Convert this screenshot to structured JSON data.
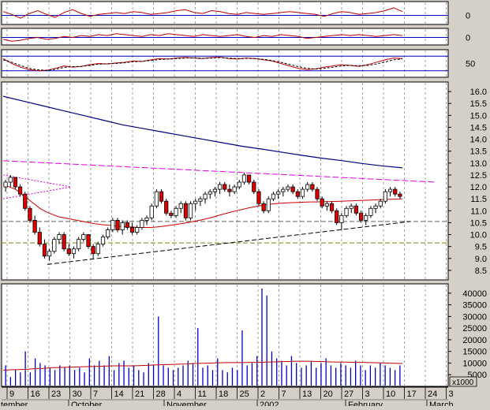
{
  "colors": {
    "background": "#d4d0c8",
    "panel": "#ffffff",
    "border": "#000000",
    "grid": "#a0a0a0",
    "price_up": "#ffffff",
    "price_down": "#e00000",
    "ma_short": "#d00000",
    "ma_long": "#000080",
    "channel": "#e000e0",
    "trend": "#000000",
    "support": "#808000",
    "volume": "#0000c0",
    "volume_ma": "#c00000",
    "indicator": "#c00000",
    "ref_line": "#0000c0"
  },
  "chart_data": [
    {
      "type": "line",
      "panel": "oscillator-1",
      "y_tick_labels": [
        "0"
      ],
      "series": [
        {
          "values": [
            0.4,
            0.1,
            -0.3,
            0.2,
            0.5,
            0.1,
            -0.2,
            0.3,
            0.6,
            0.2,
            -0.1,
            0.1,
            0.2,
            0.3,
            0.2,
            0.4,
            0.3,
            0.1,
            0.2,
            0.3,
            0.5,
            0.6,
            0.3,
            0.2,
            0.5,
            0.4,
            0.2,
            0.1,
            0.3,
            0.2,
            0.1,
            0.2,
            0.3,
            0.4,
            0.3,
            0.2,
            0.1,
            -0.1,
            0.2,
            0.4,
            0.3,
            0.1,
            0.2,
            0.3,
            0.5,
            0.8,
            0.4
          ]
        }
      ]
    },
    {
      "type": "line",
      "panel": "oscillator-2",
      "y_tick_labels": [
        "0"
      ],
      "series": [
        {
          "values": [
            -0.2,
            -0.4,
            -0.3,
            -0.1,
            0.0,
            -0.2,
            -0.1,
            0.1,
            0.0,
            0.2,
            0.1,
            0.3,
            0.2,
            0.4,
            0.3,
            0.2,
            0.1,
            0.3,
            0.2,
            0.4,
            0.3,
            0.2,
            0.1,
            0.3,
            0.2,
            0.1,
            0.2,
            0.3,
            0.1,
            0.0,
            0.2,
            0.1,
            0.3,
            0.2,
            0.1,
            -0.1,
            0.0,
            0.1,
            0.2,
            0.3,
            0.2,
            0.3,
            0.2,
            0.1,
            0.2,
            0.3,
            0.2
          ]
        }
      ]
    },
    {
      "type": "line",
      "panel": "stochastic",
      "y_tick_labels": [
        "50"
      ],
      "series": [
        {
          "values": [
            70,
            50,
            35,
            25,
            20,
            22,
            30,
            40,
            35,
            38,
            45,
            50,
            48,
            52,
            55,
            60,
            58,
            65,
            70,
            68,
            72,
            75,
            72,
            70,
            74,
            76,
            70,
            68,
            72,
            70,
            65,
            60,
            50,
            40,
            30,
            25,
            28,
            35,
            40,
            45,
            42,
            38,
            45,
            55,
            65,
            72,
            70
          ]
        },
        {
          "values": [
            65,
            55,
            42,
            30,
            24,
            22,
            26,
            34,
            37,
            38,
            42,
            47,
            49,
            50,
            53,
            57,
            59,
            62,
            66,
            68,
            70,
            72,
            73,
            71,
            72,
            74,
            72,
            70,
            71,
            70,
            67,
            62,
            55,
            46,
            37,
            30,
            27,
            30,
            35,
            40,
            42,
            41,
            42,
            48,
            56,
            65,
            69
          ]
        }
      ]
    },
    {
      "type": "line",
      "panel": "price",
      "y_tick_labels": [
        "8.5",
        "9.0",
        "9.5",
        "10.0",
        "10.5",
        "11.0",
        "11.5",
        "12.0",
        "12.5",
        "13.0",
        "13.5",
        "14.0",
        "14.5",
        "15.0",
        "15.5",
        "16.0"
      ],
      "ylim": [
        8.1,
        16.4
      ],
      "x_tick_labels": [
        "9",
        "16",
        "23",
        "30",
        "7",
        "14",
        "21",
        "28",
        "4",
        "11",
        "18",
        "25",
        "2",
        "7",
        "13",
        "20",
        "27",
        "3",
        "10",
        "17",
        "24",
        "3"
      ],
      "month_labels": [
        "tember",
        "October",
        "November",
        "2002",
        "February",
        "March"
      ],
      "ohlc": [
        [
          12.0,
          12.3,
          11.8,
          12.2
        ],
        [
          12.2,
          12.5,
          12.0,
          12.4
        ],
        [
          12.4,
          12.4,
          11.9,
          12.0
        ],
        [
          12.0,
          12.1,
          11.6,
          11.7
        ],
        [
          11.7,
          11.8,
          11.0,
          11.1
        ],
        [
          11.1,
          11.2,
          10.5,
          10.6
        ],
        [
          10.6,
          10.8,
          10.0,
          10.1
        ],
        [
          10.1,
          10.3,
          9.5,
          9.6
        ],
        [
          9.6,
          9.8,
          9.0,
          9.1
        ],
        [
          9.1,
          9.4,
          8.9,
          9.3
        ],
        [
          9.3,
          9.9,
          9.2,
          9.8
        ],
        [
          9.8,
          10.1,
          9.6,
          10.0
        ],
        [
          10.0,
          10.1,
          9.3,
          9.4
        ],
        [
          9.4,
          9.6,
          9.1,
          9.2
        ],
        [
          9.2,
          9.5,
          9.0,
          9.4
        ],
        [
          9.4,
          9.9,
          9.3,
          9.8
        ],
        [
          9.8,
          10.1,
          9.7,
          10.0
        ],
        [
          10.0,
          10.0,
          9.4,
          9.5
        ],
        [
          9.5,
          9.6,
          9.0,
          9.2
        ],
        [
          9.2,
          9.7,
          9.1,
          9.6
        ],
        [
          9.6,
          10.0,
          9.5,
          9.9
        ],
        [
          9.9,
          10.3,
          9.8,
          10.2
        ],
        [
          10.2,
          10.7,
          10.1,
          10.6
        ],
        [
          10.6,
          10.7,
          10.1,
          10.2
        ],
        [
          10.2,
          10.6,
          10.0,
          10.5
        ],
        [
          10.5,
          10.6,
          10.2,
          10.3
        ],
        [
          10.3,
          10.5,
          10.0,
          10.1
        ],
        [
          10.1,
          10.4,
          10.0,
          10.3
        ],
        [
          10.3,
          10.7,
          10.2,
          10.6
        ],
        [
          10.6,
          10.8,
          10.4,
          10.7
        ],
        [
          10.7,
          11.3,
          10.6,
          11.2
        ],
        [
          11.2,
          11.9,
          11.1,
          11.8
        ],
        [
          11.8,
          11.9,
          11.3,
          11.4
        ],
        [
          11.4,
          11.5,
          10.8,
          10.9
        ],
        [
          10.9,
          11.0,
          10.7,
          10.8
        ],
        [
          10.8,
          11.2,
          10.7,
          11.1
        ],
        [
          11.1,
          11.4,
          10.9,
          11.3
        ],
        [
          11.3,
          11.4,
          10.6,
          10.7
        ],
        [
          10.7,
          11.4,
          10.6,
          11.3
        ],
        [
          11.3,
          11.5,
          11.0,
          11.4
        ],
        [
          11.4,
          11.6,
          11.2,
          11.5
        ],
        [
          11.5,
          11.8,
          11.3,
          11.7
        ],
        [
          11.7,
          11.9,
          11.5,
          11.8
        ],
        [
          11.8,
          12.0,
          11.6,
          11.9
        ],
        [
          11.9,
          12.2,
          11.7,
          12.1
        ],
        [
          12.1,
          12.2,
          11.8,
          11.9
        ],
        [
          11.9,
          12.1,
          11.6,
          11.8
        ],
        [
          11.8,
          12.1,
          11.7,
          12.0
        ],
        [
          12.0,
          12.3,
          11.9,
          12.2
        ],
        [
          12.2,
          12.6,
          12.1,
          12.5
        ],
        [
          12.5,
          12.5,
          12.1,
          12.2
        ],
        [
          12.2,
          12.3,
          11.7,
          11.8
        ],
        [
          11.8,
          11.9,
          11.2,
          11.3
        ],
        [
          11.3,
          11.4,
          10.9,
          11.0
        ],
        [
          11.0,
          11.6,
          10.9,
          11.5
        ],
        [
          11.5,
          11.8,
          11.4,
          11.7
        ],
        [
          11.7,
          11.9,
          11.5,
          11.8
        ],
        [
          11.8,
          12.0,
          11.6,
          11.9
        ],
        [
          11.9,
          12.1,
          11.8,
          12.0
        ],
        [
          12.0,
          12.1,
          11.7,
          11.8
        ],
        [
          11.8,
          11.9,
          11.5,
          11.6
        ],
        [
          11.6,
          12.0,
          11.5,
          11.9
        ],
        [
          11.9,
          12.2,
          11.8,
          12.1
        ],
        [
          12.1,
          12.2,
          11.8,
          11.9
        ],
        [
          11.9,
          12.0,
          11.4,
          11.5
        ],
        [
          11.5,
          11.6,
          11.1,
          11.2
        ],
        [
          11.2,
          11.4,
          11.0,
          11.3
        ],
        [
          11.3,
          11.4,
          10.9,
          11.0
        ],
        [
          11.0,
          11.1,
          10.4,
          10.5
        ],
        [
          10.5,
          10.9,
          10.2,
          10.8
        ],
        [
          10.8,
          11.2,
          10.7,
          11.1
        ],
        [
          11.1,
          11.3,
          10.9,
          11.2
        ],
        [
          11.2,
          11.3,
          10.8,
          10.9
        ],
        [
          10.9,
          11.0,
          10.5,
          10.6
        ],
        [
          10.6,
          10.9,
          10.4,
          10.8
        ],
        [
          10.8,
          11.2,
          10.7,
          11.1
        ],
        [
          11.1,
          11.3,
          10.9,
          11.2
        ],
        [
          11.2,
          11.5,
          11.1,
          11.4
        ],
        [
          11.4,
          11.9,
          11.3,
          11.8
        ],
        [
          11.8,
          12.0,
          11.6,
          11.9
        ],
        [
          11.9,
          12.0,
          11.6,
          11.7
        ],
        [
          11.7,
          11.8,
          11.5,
          11.6
        ]
      ],
      "ma_short": [
        12.1,
        12.0,
        11.9,
        11.7,
        11.5,
        11.3,
        11.1,
        10.95,
        10.85,
        10.75,
        10.7,
        10.65,
        10.6,
        10.55,
        10.5,
        10.45,
        10.42,
        10.4,
        10.37,
        10.35,
        10.33,
        10.32,
        10.3,
        10.3,
        10.3,
        10.32,
        10.35,
        10.38,
        10.42,
        10.46,
        10.5,
        10.55,
        10.6,
        10.66,
        10.72,
        10.8,
        10.87,
        10.94,
        11.0,
        11.06,
        11.12,
        11.17,
        11.22,
        11.26,
        11.29,
        11.31,
        11.33,
        11.34,
        11.35,
        11.36,
        11.37,
        11.37,
        11.38,
        11.38,
        11.39,
        11.4,
        11.41,
        11.42,
        11.43,
        11.44,
        11.45,
        11.46,
        11.47,
        11.48,
        11.49,
        11.5
      ],
      "ma_long": [
        15.8,
        15.6,
        15.4,
        15.2,
        15.0,
        14.8,
        14.6,
        14.45,
        14.3,
        14.15,
        14.0,
        13.85,
        13.7,
        13.58,
        13.45,
        13.32,
        13.2,
        13.1,
        12.98,
        12.88,
        12.8
      ],
      "channel": [
        13.1,
        12.2
      ],
      "trend_support": [
        8.75,
        10.55
      ],
      "support_level": 9.65,
      "resistance_level": 10.55,
      "dashed_wedge": [
        [
          12.5,
          12.0
        ],
        [
          11.5,
          12.0
        ]
      ]
    },
    {
      "type": "bar",
      "panel": "volume",
      "y_tick_labels": [
        "5000",
        "10000",
        "15000",
        "20000",
        "25000",
        "30000",
        "35000",
        "40000"
      ],
      "ylim": [
        0,
        44000
      ],
      "unit_label": "x1000",
      "values": [
        9000,
        4000,
        7000,
        6000,
        15000,
        6000,
        12000,
        10000,
        9000,
        8000,
        7000,
        9000,
        8000,
        9000,
        7000,
        8000,
        6000,
        12000,
        9000,
        11000,
        9000,
        13000,
        7000,
        10000,
        11000,
        8000,
        9000,
        7000,
        6000,
        10000,
        9000,
        30000,
        9000,
        8000,
        7000,
        8000,
        9000,
        11000,
        10000,
        25000,
        8000,
        9000,
        7000,
        12000,
        7000,
        6000,
        8000,
        7000,
        24000,
        9000,
        10000,
        13000,
        42000,
        39000,
        15000,
        12000,
        11000,
        9000,
        13000,
        10000,
        8000,
        9000,
        11000,
        8000,
        10000,
        12000,
        9000,
        8000,
        10000,
        9000,
        8000,
        11000,
        9000,
        7000,
        9000,
        8000,
        10000,
        9000,
        8000,
        7000,
        9000
      ],
      "ma": [
        7000,
        7100,
        7200,
        7300,
        7600,
        7700,
        8000,
        8100,
        8200,
        8300,
        8400,
        8500,
        8600,
        8700,
        8800,
        8800,
        8800,
        8900,
        9000,
        9200,
        9300,
        9400,
        9500,
        9600,
        9800,
        9900,
        10000,
        10100,
        10200,
        10200,
        10200,
        10300,
        10300,
        10400,
        10500,
        10600,
        10700,
        10800,
        10800,
        10700,
        10600,
        10500,
        10400,
        10400,
        10300,
        10300,
        10200,
        10100,
        10000,
        9900,
        9800
      ]
    }
  ]
}
